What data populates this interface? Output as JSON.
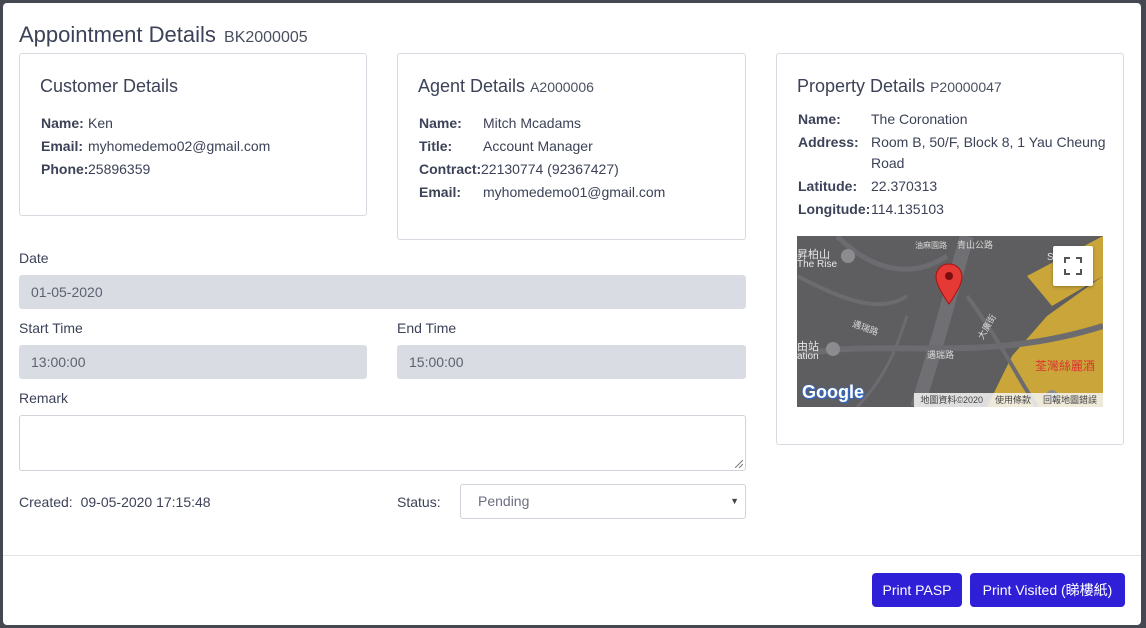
{
  "title": {
    "main": "Appointment Details",
    "code": "BK2000005"
  },
  "customer": {
    "heading": "Customer Details",
    "name_label": "Name:",
    "name": "Ken",
    "email_label": "Email:",
    "email": "myhomedemo02@gmail.com",
    "phone_label": "Phone:",
    "phone": "25896359"
  },
  "agent": {
    "heading": "Agent Details",
    "code": "A2000006",
    "name_label": "Name:",
    "name": "Mitch Mcadams",
    "title_label": "Title:",
    "title": "Account Manager",
    "contract_label": "Contract:",
    "contract": "22130774 (92367427)",
    "email_label": "Email:",
    "email": "myhomedemo01@gmail.com"
  },
  "property": {
    "heading": "Property Details",
    "code": "P20000047",
    "name_label": "Name:",
    "name": "The Coronation",
    "address_label": "Address:",
    "address_line1": "Room B, 50/F, Block 8, 1 Yau Cheung",
    "address_line2": "Road",
    "latitude_label": "Latitude:",
    "latitude": "22.370313",
    "longitude_label": "Longitude:",
    "longitude": "114.135103",
    "map": {
      "labels": [
        "昇柏山",
        "The Rise",
        "由站",
        "ation",
        "荃灣絲麗酒",
        "Shoppi",
        "遇瑞路",
        "遇瑞路",
        "大廣街",
        "油麻園路",
        "青山公路"
      ],
      "google": "Google",
      "footer": [
        "地圖資料©2020",
        "使用條款",
        "回報地圖錯誤"
      ]
    }
  },
  "form": {
    "date_label": "Date",
    "date": "01-05-2020",
    "start_label": "Start Time",
    "start": "13:00:00",
    "end_label": "End Time",
    "end": "15:00:00",
    "remark_label": "Remark",
    "remark": "",
    "created_label": "Created:",
    "created": "09-05-2020 17:15:48",
    "status_label": "Status:",
    "status": "Pending"
  },
  "buttons": {
    "print_pasp": "Print PASP",
    "print_visited": "Print Visited (睇樓紙)"
  },
  "colors": {
    "primary": "#2f1fd6",
    "disabled_field": "#d9dce2",
    "text": "#3c4257",
    "map_land": "#5e5e60",
    "map_area": "#c9a53a",
    "pin": "#e53935"
  }
}
